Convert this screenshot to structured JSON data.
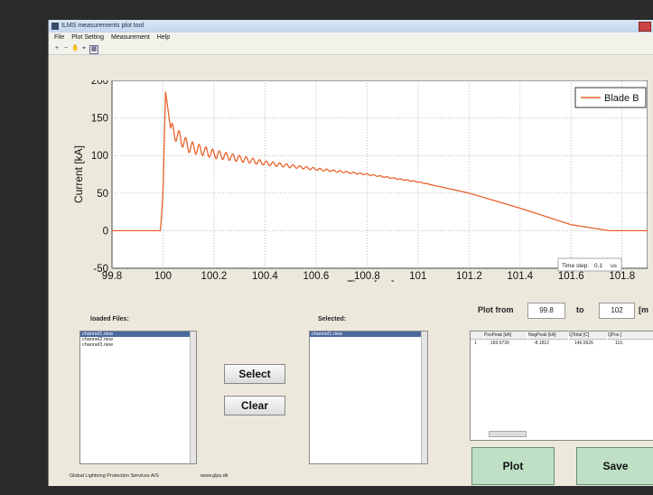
{
  "window": {
    "title": "ILMS measurements plot tool"
  },
  "menu": [
    "File",
    "Plot Setting",
    "Measurement",
    "Help"
  ],
  "toolbar_icons": [
    "zoom-in-icon",
    "zoom-out-icon",
    "pan-icon",
    "datacursor-icon",
    "grid-icon"
  ],
  "chart_data": {
    "type": "line",
    "xlabel": "Time [ms]",
    "ylabel": "Current [kA]",
    "xlim": [
      99.8,
      101.9
    ],
    "ylim": [
      -50,
      200
    ],
    "xticks": [
      "99.8",
      "100",
      "100.2",
      "100.4",
      "100.6",
      "100.8",
      "101",
      "101.2",
      "101.4",
      "101.6",
      "101.8"
    ],
    "yticks": [
      "-50",
      "0",
      "50",
      "100",
      "150",
      "200"
    ],
    "grid": true,
    "legend": "top-right",
    "series": [
      {
        "name": "Blade B",
        "color": "#e8632a",
        "x": [
          99.8,
          99.99,
          100.0,
          100.01,
          100.03,
          100.1,
          100.2,
          100.4,
          100.6,
          100.8,
          101.0,
          101.2,
          101.4,
          101.6,
          101.75,
          101.8,
          101.9
        ],
        "y": [
          0,
          0,
          50,
          185,
          135,
          112,
          102,
          90,
          82,
          75,
          65,
          50,
          30,
          8,
          0,
          0,
          0
        ]
      }
    ],
    "annotation": {
      "label": "Time step:",
      "value": "0.1",
      "unit": "us"
    }
  },
  "loaded_files": {
    "label": "loaded Files:",
    "items": [
      "channel1.riew",
      "channel2.riew",
      "channel3.riew"
    ]
  },
  "selected": {
    "label": "Selected:",
    "items": [
      "channel1.riew"
    ]
  },
  "buttons": {
    "select": "Select",
    "clear": "Clear",
    "plot": "Plot",
    "save": "Save"
  },
  "plot_range": {
    "from_label": "Plot from",
    "from_value": "99.8",
    "to_label": "to",
    "to_value": "102",
    "unit": "[m"
  },
  "results_table": {
    "headers": [
      "PosPeak [kA]",
      "NegPeak [kA]",
      "QTotal [C]",
      "QPos ["
    ],
    "rows": [
      {
        "index": "1",
        "cells": [
          "183.9730",
          "-8.1812",
          "146.5626",
          "115."
        ]
      }
    ]
  },
  "footer": {
    "company": "Global Lightning Protection Services A/S",
    "url": "www.glps.dk"
  }
}
